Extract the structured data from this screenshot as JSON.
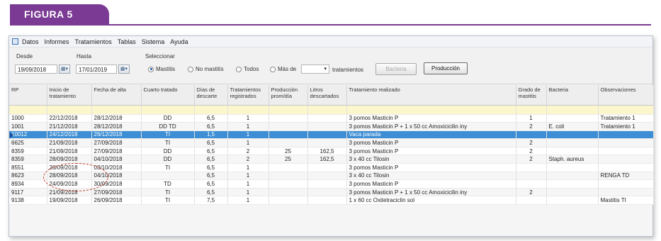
{
  "figure_label": "FIGURA 5",
  "menubar": {
    "items": [
      "Datos",
      "Informes",
      "Tratamientos",
      "Tablas",
      "Sistema",
      "Ayuda"
    ]
  },
  "filters": {
    "desde_label": "Desde",
    "desde_value": "19/09/2018",
    "hasta_label": "Hasta",
    "hasta_value": "17/01/2019",
    "seleccionar_label": "Seleccionar",
    "options": [
      {
        "label": "Mastitis",
        "selected": true
      },
      {
        "label": "No mastitis",
        "selected": false
      },
      {
        "label": "Todos",
        "selected": false
      },
      {
        "label": "Más de",
        "selected": false
      }
    ],
    "tratamientos_label": "tratamientos",
    "bacteria_button": "Bacteria",
    "produccion_button": "Producción"
  },
  "table": {
    "columns": [
      "RP",
      "Inicio de tratamiento",
      "Fecha de alta",
      "Cuarto tratado",
      "Días de descarte",
      "Tratamientos registrados",
      "Producción prom/día",
      "Litros descartados",
      "Tratamiento realizado",
      "Grado de mastitis",
      "Bacteria",
      "Observaciones"
    ],
    "rows": [
      [
        "1000",
        "22/12/2018",
        "28/12/2018",
        "DD",
        "6,5",
        "1",
        "",
        "",
        "3 pomos Masticin P",
        "1",
        "",
        "Tratamiento 1"
      ],
      [
        "1001",
        "21/12/2018",
        "28/12/2018",
        "DD TD",
        "6,5",
        "1",
        "",
        "",
        "3 pomos Masticin P   + 1 x 50 cc  Amoxicicilin iny",
        "2",
        "E. coli",
        "Tratamiento 1"
      ],
      [
        "10012",
        "24/12/2018",
        "26/12/2018",
        "TI",
        "1,5",
        "1",
        "",
        "",
        "Vaca parada",
        "",
        "",
        ""
      ],
      [
        "6625",
        "21/09/2018",
        "27/09/2018",
        "TI",
        "6,5",
        "1",
        "",
        "",
        "3 pomos Masticin P",
        "2",
        "",
        ""
      ],
      [
        "8359",
        "21/09/2018",
        "27/09/2018",
        "DD",
        "6,5",
        "2",
        "25",
        "162,5",
        "3 pomos Masticin P",
        "2",
        "",
        ""
      ],
      [
        "8359",
        "28/09/2018",
        "04/10/2018",
        "DD",
        "6,5",
        "2",
        "25",
        "162,5",
        "3 x 40 cc Tilosin",
        "2",
        "Staph. aureus",
        ""
      ],
      [
        "8551",
        "26/09/2018",
        "03/10/2018",
        "TI",
        "6,5",
        "1",
        "",
        "",
        "3 pomos Masticin P",
        "",
        "",
        ""
      ],
      [
        "8623",
        "28/09/2018",
        "04/10/2018",
        "",
        "6,5",
        "1",
        "",
        "",
        "3 x 40 cc Tilosin",
        "",
        "",
        "RENGA TD"
      ],
      [
        "8934",
        "24/09/2018",
        "30/09/2018",
        "TD",
        "6,5",
        "1",
        "",
        "",
        "3 pomos Masticin P",
        "",
        "",
        ""
      ],
      [
        "9117",
        "21/09/2018",
        "27/09/2018",
        "TI",
        "6,5",
        "1",
        "",
        "",
        "3 pomos Masticin P   + 1 x 50 cc  Amoxicicilin iny",
        "2",
        "",
        ""
      ],
      [
        "9138",
        "19/09/2018",
        "26/09/2018",
        "TI",
        "7,5",
        "1",
        "",
        "",
        "1 x 60 cc Oxitetraciclin sol",
        "",
        "",
        "Mastitis TI"
      ]
    ],
    "selected_row": 2
  },
  "colors": {
    "figure_tab": "#7b3a93",
    "selected_row": "#3d8ed4",
    "filter_row": "#fbf6cc",
    "annotation_circle": "#c0392b"
  }
}
